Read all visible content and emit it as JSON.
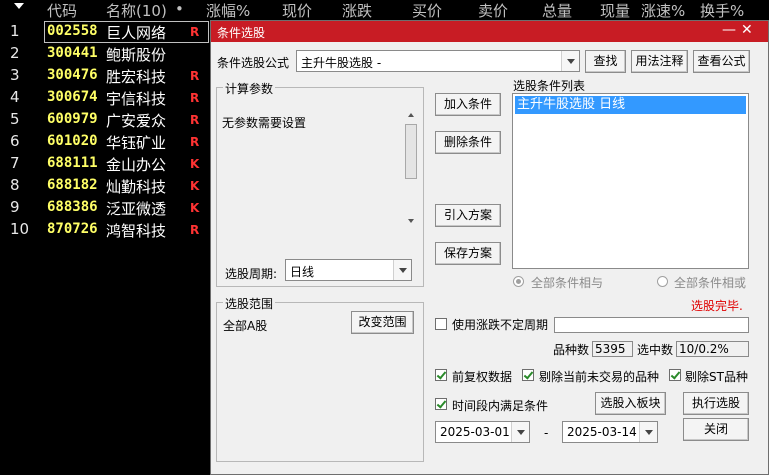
{
  "header": {
    "menu_icon": "triangle-down-icon",
    "columns": [
      "代码",
      "名称(10)",
      "•",
      "涨幅%",
      "现价",
      "涨跌",
      "买价",
      "卖价",
      "总量",
      "现量",
      "涨速%",
      "换手%"
    ]
  },
  "stocks": [
    {
      "n": "1",
      "code": "002558",
      "name": "巨人网络",
      "badge": "R"
    },
    {
      "n": "2",
      "code": "300441",
      "name": "鲍斯股份",
      "badge": ""
    },
    {
      "n": "3",
      "code": "300476",
      "name": "胜宏科技",
      "badge": "R"
    },
    {
      "n": "4",
      "code": "300674",
      "name": "宇信科技",
      "badge": "R"
    },
    {
      "n": "5",
      "code": "600979",
      "name": "广安爱众",
      "badge": "R"
    },
    {
      "n": "6",
      "code": "601020",
      "name": "华钰矿业",
      "badge": "R"
    },
    {
      "n": "7",
      "code": "688111",
      "name": "金山办公",
      "badge": "K"
    },
    {
      "n": "8",
      "code": "688182",
      "name": "灿勤科技",
      "badge": "K"
    },
    {
      "n": "9",
      "code": "688386",
      "name": "泛亚微透",
      "badge": "K"
    },
    {
      "n": "10",
      "code": "870726",
      "name": "鸿智科技",
      "badge": "R"
    }
  ],
  "dialog": {
    "title": "条件选股",
    "minimize": "—",
    "close": "✕",
    "formula_label": "条件选股公式",
    "formula_value": "主升牛股选股 -",
    "find": "查找",
    "usage": "用法注释",
    "view_formula": "查看公式",
    "params_group": "计算参数",
    "params_text": "无参数需要设置",
    "period_label": "选股周期:",
    "period_value": "日线",
    "add_condition": "加入条件",
    "delete_condition": "删除条件",
    "import_plan": "引入方案",
    "save_plan": "保存方案",
    "list_title": "选股条件列表",
    "list_items": [
      "主升牛股选股  日线"
    ],
    "radio_and": "全部条件相与",
    "radio_or": "全部条件相或",
    "status": "选股完毕.",
    "range_group": "选股范围",
    "range_value": "全部A股",
    "change_range": "改变范围",
    "use_period_label": "使用涨跌不定周期",
    "count_label": "品种数",
    "count_value": "5395",
    "selected_label": "选中数",
    "selected_value": "10/0.2%",
    "adj_label": "前复权数据",
    "exclude_untraded": "剔除当前未交易的品种",
    "exclude_st": "剔除ST品种",
    "within_period": "时间段内满足条件",
    "to_block": "选股入板块",
    "execute": "执行选股",
    "date_from": "2025-03-01",
    "date_sep": "-",
    "date_to": "2025-03-14",
    "close_btn": "关闭"
  },
  "colors": {
    "code": "#ffff66",
    "badge_r": "#ff3333",
    "badge_k": "#ff3333",
    "title_bar": "#c81c24",
    "status": "#e00000"
  }
}
